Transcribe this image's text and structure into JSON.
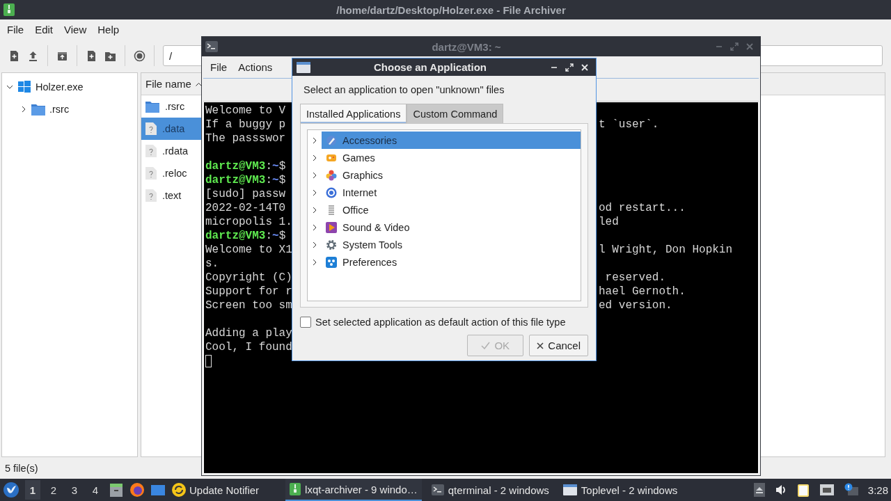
{
  "archiver": {
    "title": "/home/dartz/Desktop/Holzer.exe - File Archiver",
    "menu": [
      "File",
      "Edit",
      "View",
      "Help"
    ],
    "path": "/",
    "tree": [
      {
        "label": "Holzer.exe",
        "kind": "archive",
        "expanded": true,
        "children": [
          {
            "label": ".rsrc",
            "kind": "folder",
            "expanded": false
          }
        ]
      }
    ],
    "list_header": {
      "label": "File name",
      "sorted": true
    },
    "files": [
      {
        "name": ".rsrc",
        "kind": "folder",
        "selected": false
      },
      {
        "name": ".data",
        "kind": "unknown",
        "selected": true
      },
      {
        "name": ".rdata",
        "kind": "unknown",
        "selected": false
      },
      {
        "name": ".reloc",
        "kind": "unknown",
        "selected": false
      },
      {
        "name": ".text",
        "kind": "unknown",
        "selected": false
      }
    ],
    "status": "5 file(s)"
  },
  "terminal": {
    "title": "dartz@VM3: ~",
    "menu": [
      "File",
      "Actions"
    ],
    "lines": [
      {
        "kind": "text",
        "left": "Welcome to V"
      },
      {
        "kind": "text",
        "left": "If a buggy p",
        "right": "t `user`."
      },
      {
        "kind": "text",
        "left": "The passswor"
      },
      {
        "kind": "blank"
      },
      {
        "kind": "prompt",
        "user": "dartz@VM3",
        "separator": ":",
        "path": "~",
        "symbol": "$"
      },
      {
        "kind": "prompt",
        "user": "dartz@VM3",
        "separator": ":",
        "path": "~",
        "symbol": "$"
      },
      {
        "kind": "text",
        "left": "[sudo] passw"
      },
      {
        "kind": "text",
        "left": "2022-02-14T0",
        "right": "od restart..."
      },
      {
        "kind": "text",
        "left": "micropolis 1.",
        "right": "led"
      },
      {
        "kind": "prompt",
        "user": "dartz@VM3",
        "separator": ":",
        "path": "~",
        "symbol": "$"
      },
      {
        "kind": "text",
        "left": "Welcome to X1",
        "right": "l Wright, Don Hopkin"
      },
      {
        "kind": "text",
        "left": "s."
      },
      {
        "kind": "text",
        "left": "Copyright (C)",
        "right": " reserved."
      },
      {
        "kind": "text",
        "left": "Support for r",
        "right": "hael Gernoth."
      },
      {
        "kind": "text",
        "left": "Screen too sm",
        "right": "ed version."
      },
      {
        "kind": "blank"
      },
      {
        "kind": "text",
        "left": "Adding a play"
      },
      {
        "kind": "text",
        "left": "Cool, I found"
      },
      {
        "kind": "cursor"
      }
    ]
  },
  "dialog": {
    "title": "Choose an Application",
    "prompt": "Select an application to open \"unknown\" files",
    "tabs": [
      {
        "label": "Installed Applications",
        "selected": true
      },
      {
        "label": "Custom Command",
        "selected": false
      }
    ],
    "categories": [
      {
        "label": "Accessories",
        "kind": "accessories",
        "selected": true,
        "expanded": false
      },
      {
        "label": "Games",
        "kind": "games",
        "selected": false,
        "expanded": false
      },
      {
        "label": "Graphics",
        "kind": "graphics",
        "selected": false,
        "expanded": false
      },
      {
        "label": "Internet",
        "kind": "internet",
        "selected": false,
        "expanded": false
      },
      {
        "label": "Office",
        "kind": "office",
        "selected": false,
        "expanded": false
      },
      {
        "label": "Sound & Video",
        "kind": "multimedia",
        "selected": false,
        "expanded": false
      },
      {
        "label": "System Tools",
        "kind": "system",
        "selected": false,
        "expanded": false
      },
      {
        "label": "Preferences",
        "kind": "preferences",
        "selected": false,
        "expanded": false
      }
    ],
    "default_checkbox": {
      "label": "Set selected application as default action of this file type",
      "checked": false
    },
    "buttons": [
      {
        "label": "OK",
        "kind": "ok",
        "disabled": true
      },
      {
        "label": "Cancel",
        "kind": "cancel",
        "disabled": false
      }
    ]
  },
  "taskbar": {
    "workspaces": [
      {
        "label": "1",
        "selected": true
      },
      {
        "label": "2",
        "selected": false
      },
      {
        "label": "3",
        "selected": false
      },
      {
        "label": "4",
        "selected": false
      }
    ],
    "notifier": "Update Notifier",
    "tasks": [
      {
        "label": "lxqt-archiver - 9 windo…",
        "kind": "archiver",
        "selected": true
      },
      {
        "label": "qterminal - 2 windows",
        "kind": "terminal",
        "selected": false
      },
      {
        "label": "Toplevel - 2 windows",
        "kind": "window",
        "selected": false
      }
    ],
    "clock": "3:28"
  }
}
